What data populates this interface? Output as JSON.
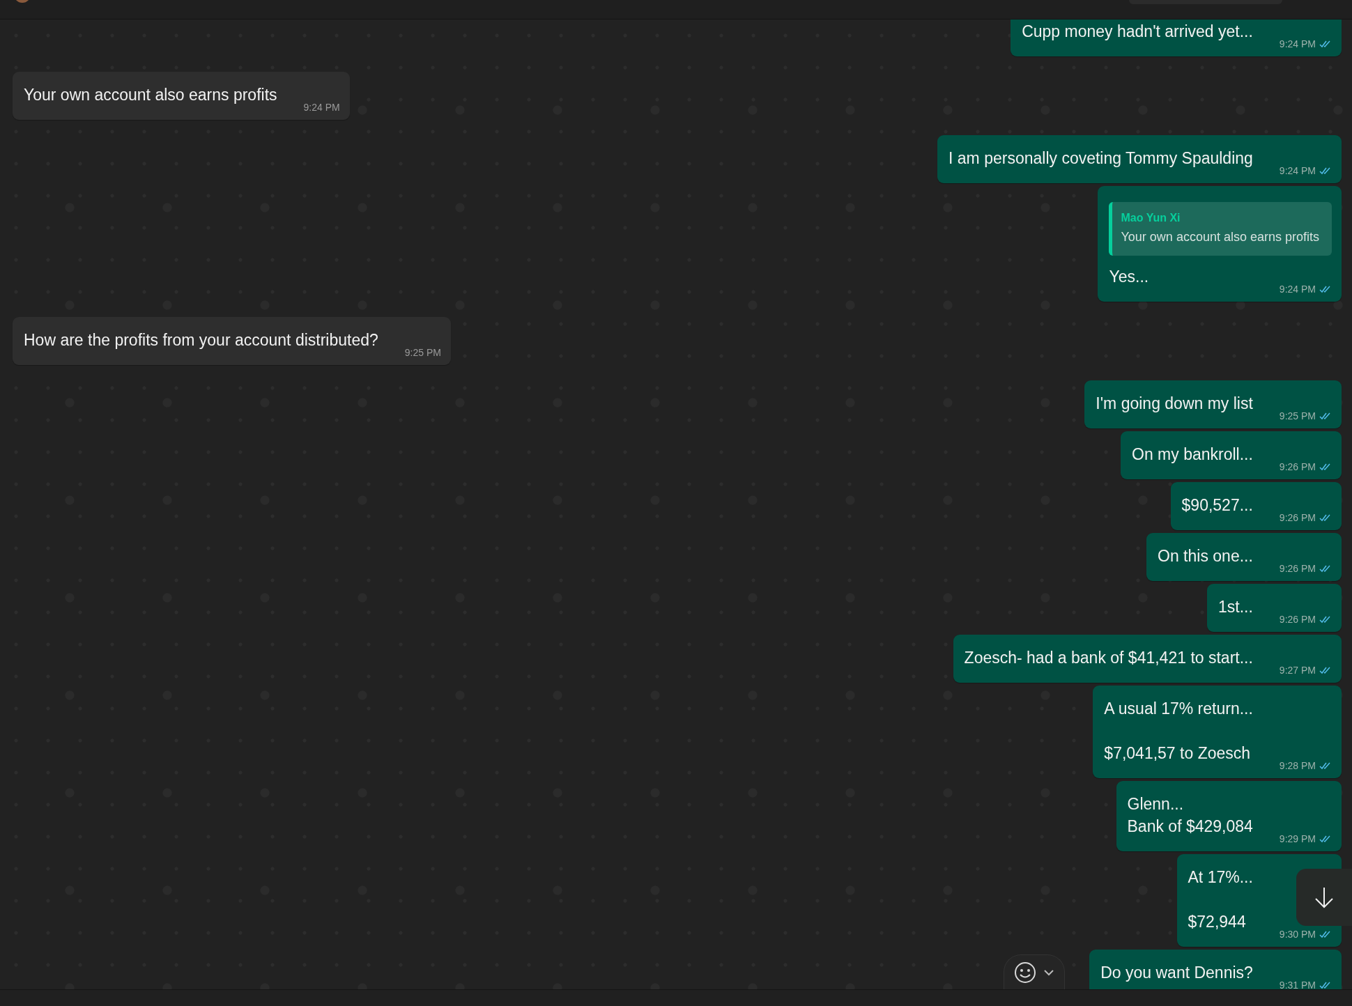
{
  "messages": [
    {
      "kind": "outgoing",
      "text": "Cupp money hadn't arrived yet...",
      "time": "9:24 PM",
      "read": true
    },
    {
      "kind": "incoming",
      "text": "Your own account also earns profits",
      "time": "9:24 PM"
    },
    {
      "kind": "outgoing",
      "text": "I am personally coveting Tommy Spaulding",
      "time": "9:24 PM",
      "read": true
    },
    {
      "kind": "outgoing",
      "quote": {
        "author": "Mao Yun Xi",
        "text": "Your own account also earns profits"
      },
      "text": "Yes...",
      "time": "9:24 PM",
      "read": true
    },
    {
      "kind": "incoming",
      "text": "How are the profits from your account distributed?",
      "time": "9:25 PM"
    },
    {
      "kind": "outgoing",
      "text": "I'm going down my list",
      "time": "9:25 PM",
      "read": true
    },
    {
      "kind": "outgoing",
      "text": "On my bankroll...",
      "time": "9:26 PM",
      "read": true
    },
    {
      "kind": "outgoing",
      "text": "$90,527...",
      "time": "9:26 PM",
      "read": true
    },
    {
      "kind": "outgoing",
      "text": "On this one...",
      "time": "9:26 PM",
      "read": true
    },
    {
      "kind": "outgoing",
      "text": "1st...",
      "time": "9:26 PM",
      "read": true
    },
    {
      "kind": "outgoing",
      "text": "Zoesch- had a bank of $41,421 to start...",
      "time": "9:27 PM",
      "read": true
    },
    {
      "kind": "outgoing",
      "text": "A usual 17% return...\n\n$7,041,57 to Zoesch",
      "time": "9:28 PM",
      "read": true
    },
    {
      "kind": "outgoing",
      "text": "Glenn...\nBank of $429,084",
      "time": "9:29 PM",
      "read": true
    },
    {
      "kind": "outgoing",
      "text": "At 17%...\n\n$72,944",
      "time": "9:30 PM",
      "read": true
    },
    {
      "kind": "outgoing",
      "text": "Do you want Dennis?",
      "time": "9:31 PM",
      "read": true
    }
  ]
}
